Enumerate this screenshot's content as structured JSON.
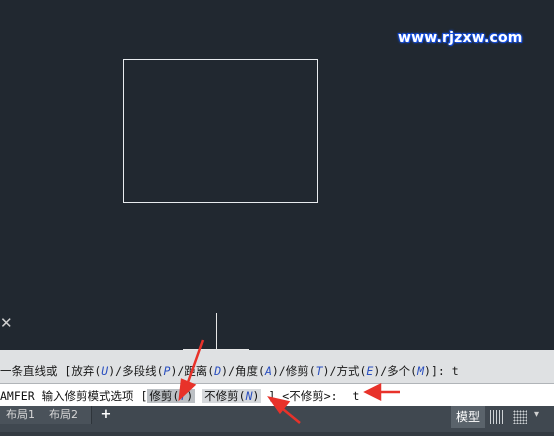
{
  "watermark": "www.rjzxw.com",
  "history": {
    "prefix": "一条直线或 [放弃(",
    "k1": "U",
    "s1": ")/多段线(",
    "k2": "P",
    "s2": ")/距离(",
    "k3": "D",
    "s3": ")/角度(",
    "k4": "A",
    "s4": ")/修剪(",
    "k5": "T",
    "s5": ")/方式(",
    "k6": "E",
    "s6": ")/多个(",
    "k7": "M",
    "s7": ")]:  t"
  },
  "command": {
    "name": "AMFER",
    "prompt": "输入修剪模式选项 [",
    "opt1_label": "修剪(",
    "opt1_key": "T",
    "opt1_close": ")",
    "opt2_label": "不修剪(",
    "opt2_key": "N",
    "opt2_close": ")",
    "suffix": "] <不修剪>:",
    "typed": "t"
  },
  "status": {
    "tab1": "布局1",
    "tab2": "布局2",
    "add_tab": "+",
    "model": "模型",
    "dropdown": "▾"
  },
  "colors": {
    "canvas": "#212830",
    "annotation_arrow": "#e8322a"
  }
}
